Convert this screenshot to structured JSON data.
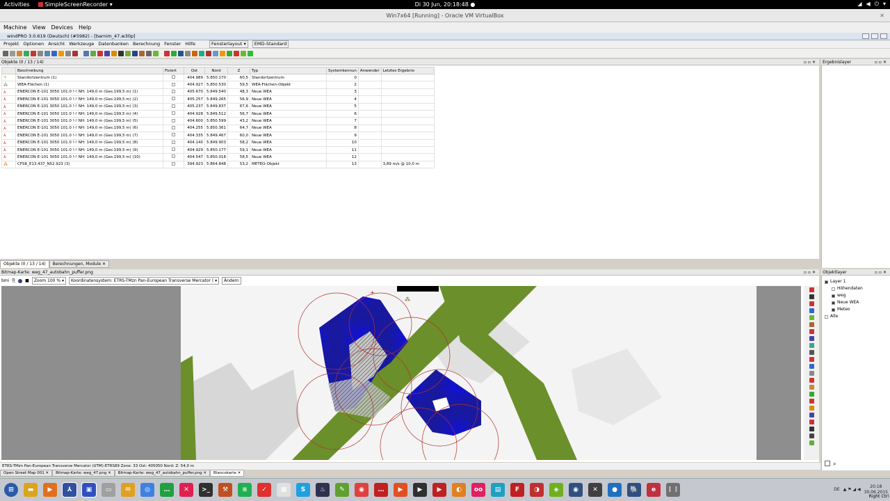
{
  "top_bar": {
    "activities": "Activities",
    "app_name": "SimpleScreenRecorder ▾",
    "clock": "Di 30 Jun, 20:18:48 ●"
  },
  "vbox": {
    "title": "Win7x64 [Running] - Oracle VM VirtualBox",
    "menu": [
      "Machine",
      "View",
      "Devices",
      "Help"
    ],
    "host_key": "Right Ctrl"
  },
  "app": {
    "title": "windPRO 3.0.619 (Deutsch) (#5982) - [barnim_47.w30p]",
    "menu": [
      "Projekt",
      "Optionen",
      "Ansicht",
      "Werkzeuge",
      "Datenbanken",
      "Berechnung",
      "Fenster",
      "Hilfe"
    ],
    "layout_menu": "Fensterlayout ▾",
    "layout_value": "EMD-Standard",
    "toolbar_icon_colors": [
      "#666",
      "#999",
      "#c83",
      "#3a6",
      "#c33",
      "#888",
      "#58a",
      "#36c",
      "#e90",
      "#888",
      "#a33",
      "#57a",
      "#6a4",
      "#c33",
      "#44a",
      "#d80",
      "#333",
      "#7a3",
      "#248",
      "#a63",
      "#666",
      "#6b3",
      "#c33",
      "#3a3",
      "#258",
      "#888",
      "#c60",
      "#2a8",
      "#a33",
      "#69c",
      "#e90",
      "#3a3",
      "#c33",
      "#6b3",
      "#3b3"
    ]
  },
  "objects": {
    "panel_title": "Objekte (0 / 13 / 14)",
    "columns": [
      "",
      "Beschreibung",
      "Fixiert",
      "Ost",
      "Nord",
      "Z",
      "Typ",
      "Systemkennun",
      "Anwender",
      "Letztes Ergebnis"
    ],
    "rows": [
      {
        "icon": "+",
        "icon_color": "#d08000",
        "desc": "Standortzentrum (1)",
        "ost": "404.989",
        "nord": "5.850.170",
        "z": "60,5",
        "typ": "Standortzentrum",
        "sys": "0",
        "result": ""
      },
      {
        "icon": "⁂",
        "icon_color": "#2a7a2a",
        "desc": "WEA-Flächen (1)",
        "ost": "404.927",
        "nord": "5.850.530",
        "z": "59,5",
        "typ": "WEA-Flächen-Objekt",
        "sys": "2",
        "result": ""
      },
      {
        "icon": "⅄",
        "icon_color": "#c00000",
        "desc": "ENERCON E-101 3050 101.0 !-! NH: 149,0 m (Ges:199,5 m) (1)",
        "ost": "405.670",
        "nord": "5.849.540",
        "z": "48,3",
        "typ": "Neue WEA",
        "sys": "3",
        "result": ""
      },
      {
        "icon": "⅄",
        "icon_color": "#c00000",
        "desc": "ENERCON E-101 3050 101.0 !-! NH: 149,0 m (Ges:199,5 m) (2)",
        "ost": "405.257",
        "nord": "5.849.265",
        "z": "56,9",
        "typ": "Neue WEA",
        "sys": "4",
        "result": ""
      },
      {
        "icon": "⅄",
        "icon_color": "#c00000",
        "desc": "ENERCON E-101 3050 101.0 !-! NH: 149,0 m (Ges:199,5 m) (3)",
        "ost": "405.237",
        "nord": "5.849.837",
        "z": "67,6",
        "typ": "Neue WEA",
        "sys": "5",
        "result": ""
      },
      {
        "icon": "⅄",
        "icon_color": "#c00000",
        "desc": "ENERCON E-101 3050 101.0 !-! NH: 149,0 m (Ges:199,5 m) (4)",
        "ost": "404.928",
        "nord": "5.849.512",
        "z": "56,7",
        "typ": "Neue WEA",
        "sys": "6",
        "result": ""
      },
      {
        "icon": "⅄",
        "icon_color": "#c00000",
        "desc": "ENERCON E-101 3050 101.0 !-! NH: 149,0 m (Ges:199,5 m) (5)",
        "ost": "404.600",
        "nord": "5.850.599",
        "z": "43,2",
        "typ": "Neue WEA",
        "sys": "7",
        "result": ""
      },
      {
        "icon": "⅄",
        "icon_color": "#c00000",
        "desc": "ENERCON E-101 3050 101.0 !-! NH: 149,0 m (Ges:199,5 m) (6)",
        "ost": "404.255",
        "nord": "5.850.361",
        "z": "64,7",
        "typ": "Neue WEA",
        "sys": "8",
        "result": ""
      },
      {
        "icon": "⅄",
        "icon_color": "#c00000",
        "desc": "ENERCON E-101 3050 101.0 !-! NH: 149,0 m (Ges:199,5 m) (7)",
        "ost": "404.335",
        "nord": "5.849.467",
        "z": "60,0",
        "typ": "Neue WEA",
        "sys": "9",
        "result": ""
      },
      {
        "icon": "⅄",
        "icon_color": "#c00000",
        "desc": "ENERCON E-101 3050 101.0 !-! NH: 149,0 m (Ges:199,5 m) (8)",
        "ost": "404.140",
        "nord": "5.849.903",
        "z": "58,2",
        "typ": "Neue WEA",
        "sys": "10",
        "result": ""
      },
      {
        "icon": "⅄",
        "icon_color": "#c00000",
        "desc": "ENERCON E-101 3050 101.0 !-! NH: 149,0 m (Ges:199,5 m) (9)",
        "ost": "404.929",
        "nord": "5.850.177",
        "z": "59,1",
        "typ": "Neue WEA",
        "sys": "11",
        "result": ""
      },
      {
        "icon": "⅄",
        "icon_color": "#c00000",
        "desc": "ENERCON E-101 3050 101.0 !-! NH: 149,0 m (Ges:199,5 m) (10)",
        "ost": "404.547",
        "nord": "5.850.018",
        "z": "58,5",
        "typ": "Neue WEA",
        "sys": "12",
        "result": ""
      },
      {
        "icon": "⁂",
        "icon_color": "#cc6600",
        "desc": "CFSR_E13.437_N52.923 (3)",
        "ost": "394.923",
        "nord": "5.864.848",
        "z": "53,2",
        "typ": "METEO-Objekt",
        "sys": "13",
        "result": "3,89 m/s @ 10,0 m"
      }
    ]
  },
  "tabs_top": [
    "Objekte (0 / 13 / 14)",
    "Berechnungen, Module ✕"
  ],
  "map": {
    "panel_title": "Bitmap-Karte: weg_47_autobahn_puffer.png",
    "bmi_label": "bmi",
    "zoom_label": "Zoom",
    "zoom_value": "100 %",
    "coord_label": "Koordinatensystem: ETRS-TMzn Pan-European Transverse Mercator (",
    "change_button": "Ändern",
    "vtool_colors": [
      "#c33",
      "#333",
      "#c33",
      "#36c",
      "#6b3",
      "#a63",
      "#c33",
      "#44a",
      "#3a8",
      "#555",
      "#c33",
      "#36c",
      "#888",
      "#c33",
      "#c83",
      "#3a3",
      "#c33",
      "#d80",
      "#44a",
      "#c33",
      "#333",
      "#444",
      "#6a4"
    ]
  },
  "status_text": "ETRS-TMzn Pan-European Transverse Mercator (UTM)-ETRS89 Zone: 33  Ost: 405050  Nord:   Z: 54,0 m",
  "tabs_bottom": [
    "Open Street Map 001 ✕",
    "Bitmap-Karte: weg_47.png ✕",
    "Bitmap-Karte: weg_47_autobahn_puffer.png ✕",
    "Blancokarte ✕"
  ],
  "results_panel": {
    "title": "Ergebnislayer"
  },
  "layers_panel": {
    "title": "Objektlayer",
    "items": [
      {
        "label": "Layer 1",
        "checked": true
      },
      {
        "label": "Höhendaten",
        "checked": false
      },
      {
        "label": "weg",
        "checked": true
      },
      {
        "label": "Neue WEA",
        "checked": true
      },
      {
        "label": "Meteo",
        "checked": true
      },
      {
        "label": "Alle",
        "checked": false
      }
    ]
  },
  "taskbar": {
    "start_icon": "windows-start-icon",
    "apps": [
      {
        "name": "explorer",
        "color": "#d9a520",
        "glyph": "▬"
      },
      {
        "name": "media-player",
        "color": "#e07020",
        "glyph": "▶"
      },
      {
        "name": "windpro",
        "color": "#3050a0",
        "glyph": "⅄"
      },
      {
        "name": "save",
        "color": "#3050c0",
        "glyph": "▣"
      },
      {
        "name": "files",
        "color": "#a0a0a0",
        "glyph": "▭"
      },
      {
        "name": "mail",
        "color": "#e0a020",
        "glyph": "✉"
      },
      {
        "name": "chrome",
        "color": "#4080e0",
        "glyph": "◎"
      },
      {
        "name": "hangouts",
        "color": "#20a040",
        "glyph": "…"
      },
      {
        "name": "xmind",
        "color": "#e02050",
        "glyph": "✕"
      },
      {
        "name": "terminal",
        "color": "#303030",
        "glyph": ">_"
      },
      {
        "name": "tool",
        "color": "#c05020",
        "glyph": "⚒"
      },
      {
        "name": "spotify",
        "color": "#20b050",
        "glyph": "≋"
      },
      {
        "name": "todo",
        "color": "#e03030",
        "glyph": "✓"
      },
      {
        "name": "calendar",
        "color": "#e0e0e0",
        "glyph": "▦"
      },
      {
        "name": "skype",
        "color": "#20a0e0",
        "glyph": "S"
      },
      {
        "name": "steam",
        "color": "#303050",
        "glyph": "♨"
      },
      {
        "name": "edit",
        "color": "#60a030",
        "glyph": "✎"
      },
      {
        "name": "record",
        "color": "#e04040",
        "glyph": "◉"
      },
      {
        "name": "chat",
        "color": "#c02020",
        "glyph": "…"
      },
      {
        "name": "play",
        "color": "#e05020",
        "glyph": "▶"
      },
      {
        "name": "play2",
        "color": "#303030",
        "glyph": "▶"
      },
      {
        "name": "video",
        "color": "#c02020",
        "glyph": "▶"
      },
      {
        "name": "ff",
        "color": "#e08020",
        "glyph": "◐"
      },
      {
        "name": "oo",
        "color": "#e02060",
        "glyph": "oo"
      },
      {
        "name": "docs",
        "color": "#20a0c0",
        "glyph": "▤"
      },
      {
        "name": "filezilla",
        "color": "#c02020",
        "glyph": "F"
      },
      {
        "name": "toggle",
        "color": "#c03030",
        "glyph": "◑"
      },
      {
        "name": "nvidia",
        "color": "#70b020",
        "glyph": "◈"
      },
      {
        "name": "camera",
        "color": "#305080",
        "glyph": "◉"
      },
      {
        "name": "x",
        "color": "#404040",
        "glyph": "✕"
      },
      {
        "name": "drop",
        "color": "#2070c0",
        "glyph": "●"
      },
      {
        "name": "pg",
        "color": "#305080",
        "glyph": "🐘"
      },
      {
        "name": "e",
        "color": "#c03040",
        "glyph": "e"
      },
      {
        "name": "apps",
        "color": "#707070",
        "glyph": "⋮⋮"
      }
    ],
    "lang": "DE",
    "time": "20:18",
    "date": "30.06.2015"
  }
}
